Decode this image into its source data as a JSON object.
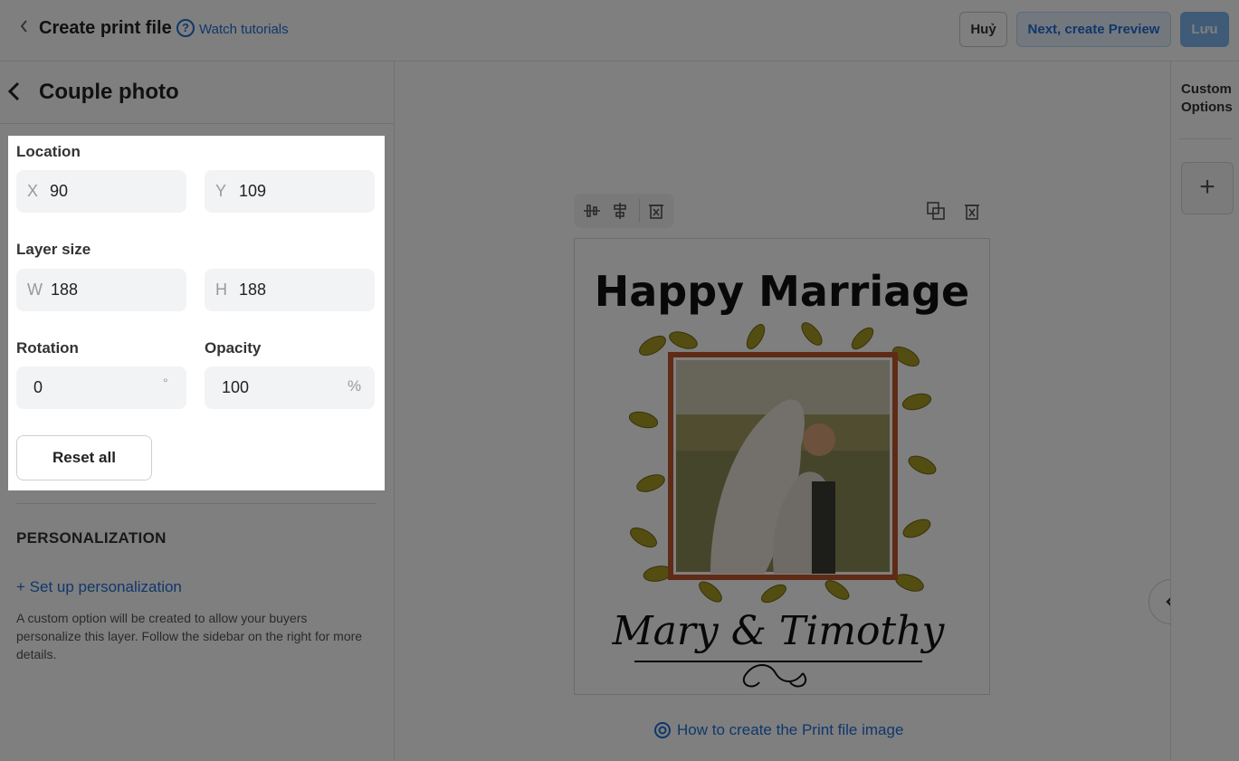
{
  "header": {
    "title": "Create print file",
    "tutorial_link": "Watch tutorials",
    "cancel_label": "Huỷ",
    "next_label": "Next, create Preview",
    "save_label": "Lưu"
  },
  "panel": {
    "title": "Couple photo",
    "location": {
      "label": "Location",
      "x_prefix": "X",
      "x_value": "90",
      "y_prefix": "Y",
      "y_value": "109"
    },
    "layer_size": {
      "label": "Layer size",
      "w_prefix": "W",
      "w_value": "188",
      "h_prefix": "H",
      "h_value": "188"
    },
    "rotation": {
      "label": "Rotation",
      "value": "0",
      "unit": "°"
    },
    "opacity": {
      "label": "Opacity",
      "value": "100",
      "unit": "%"
    },
    "reset_label": "Reset all",
    "personalization": {
      "title": "PERSONALIZATION",
      "link": "+ Set up personalization",
      "description": "A custom option will be created to allow your buyers personalize this layer. Follow the sidebar on the right for more details."
    }
  },
  "canvas": {
    "artwork": {
      "headline": "Happy Marriage",
      "names": "Mary & Timothy"
    },
    "help_link": "How to create the Print file image"
  },
  "right_rail": {
    "title": "Custom Options",
    "add_label": "+"
  },
  "colors": {
    "accent": "#1f6fd6",
    "frame": "#c0562a",
    "leaf": "#a99a22"
  }
}
